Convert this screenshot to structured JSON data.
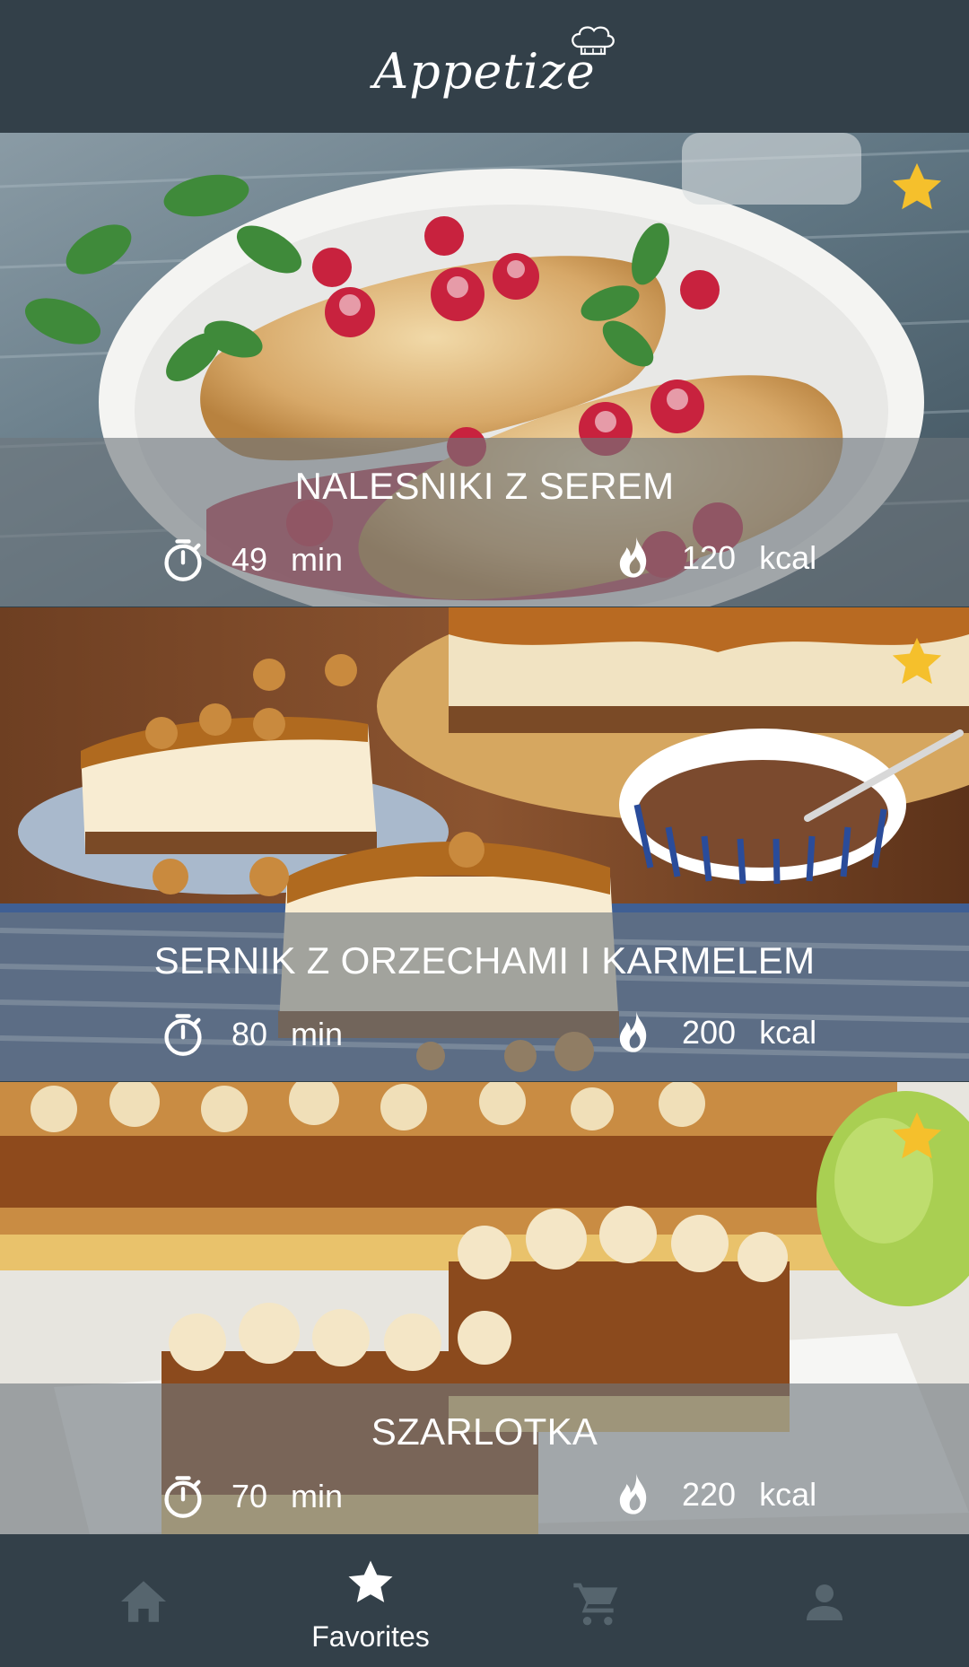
{
  "app": {
    "title": "Appetize"
  },
  "recipes": [
    {
      "name": "NALESNIKI Z SEREM",
      "time_value": "49",
      "time_unit": "min",
      "kcal_value": "120",
      "kcal_unit": "kcal",
      "favorite": true
    },
    {
      "name": "SERNIK Z ORZECHAMI I KARMELEM",
      "time_value": "80",
      "time_unit": "min",
      "kcal_value": "200",
      "kcal_unit": "kcal",
      "favorite": true
    },
    {
      "name": "SZARLOTKA",
      "time_value": "70",
      "time_unit": "min",
      "kcal_value": "220",
      "kcal_unit": "kcal",
      "favorite": true
    }
  ],
  "nav": {
    "items": [
      {
        "icon": "home-icon",
        "label": ""
      },
      {
        "icon": "star-icon",
        "label": "Favorites",
        "active": true
      },
      {
        "icon": "cart-icon",
        "label": ""
      },
      {
        "icon": "account-icon",
        "label": ""
      }
    ]
  },
  "colors": {
    "header_bg": "#334049",
    "nav_bg": "#334049",
    "favorite_star": "#f5c02c",
    "nav_inactive": "#56656e",
    "nav_active": "#ffffff"
  }
}
